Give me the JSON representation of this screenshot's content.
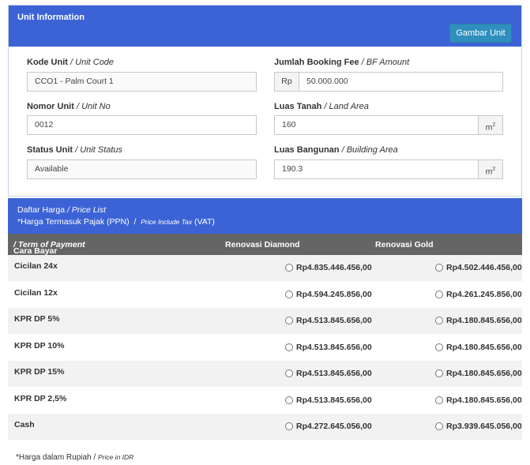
{
  "unit_info": {
    "title": "Unit Information",
    "gambar_button": "Gambar Unit",
    "kode_unit": {
      "label": "Kode Unit",
      "label_en": "/ Unit Code",
      "value": "CCO1 - Palm Court 1"
    },
    "nomor_unit": {
      "label": "Nomor Unit",
      "label_en": "/ Unit No",
      "value": "0012"
    },
    "status_unit": {
      "label": "Status Unit",
      "label_en": "/ Unit Status",
      "value": "Available"
    },
    "booking_fee": {
      "label": "Jumlah Booking Fee",
      "label_en": "/ BF Amount",
      "prefix": "Rp",
      "value": "50.000.000"
    },
    "luas_tanah": {
      "label": "Luas Tanah",
      "label_en": "/ Land Area",
      "value": "160",
      "unit": "m",
      "unit_sup": "2"
    },
    "luas_bangunan": {
      "label": "Luas Bangunan",
      "label_en": "/ Building Area",
      "value": "190.3",
      "unit": "m",
      "unit_sup": "2"
    }
  },
  "price_list": {
    "title": "Daftar Harga",
    "title_en": "/ Price List",
    "tax_note": "*Harga Termasuk Pajak (PPN)",
    "tax_sep": "/",
    "tax_note_en": "Price Include Tax",
    "tax_vat": "(VAT)",
    "columns": {
      "term": "Cara Bayar",
      "term_en": "/ Term of Payment",
      "diamond": "Renovasi Diamond",
      "gold": "Renovasi Gold"
    },
    "rows": [
      {
        "name": "Cicilan 24x",
        "diamond": "Rp4.835.446.456,00",
        "gold": "Rp4.502.446.456,00"
      },
      {
        "name": "Cicilan 12x",
        "diamond": "Rp4.594.245.856,00",
        "gold": "Rp4.261.245.856,00"
      },
      {
        "name": "KPR DP 5%",
        "diamond": "Rp4.513.845.656,00",
        "gold": "Rp4.180.845.656,00"
      },
      {
        "name": "KPR DP 10%",
        "diamond": "Rp4.513.845.656,00",
        "gold": "Rp4.180.845.656,00"
      },
      {
        "name": "KPR DP 15%",
        "diamond": "Rp4.513.845.656,00",
        "gold": "Rp4.180.845.656,00"
      },
      {
        "name": "KPR DP 2,5%",
        "diamond": "Rp4.513.845.656,00",
        "gold": "Rp4.180.845.656,00"
      },
      {
        "name": "Cash",
        "diamond": "Rp4.272.645.056,00",
        "gold": "Rp3.939.645.056,00"
      }
    ],
    "footnote": "*Harga dalam Rupiah /",
    "footnote_en": "Price in IDR"
  }
}
